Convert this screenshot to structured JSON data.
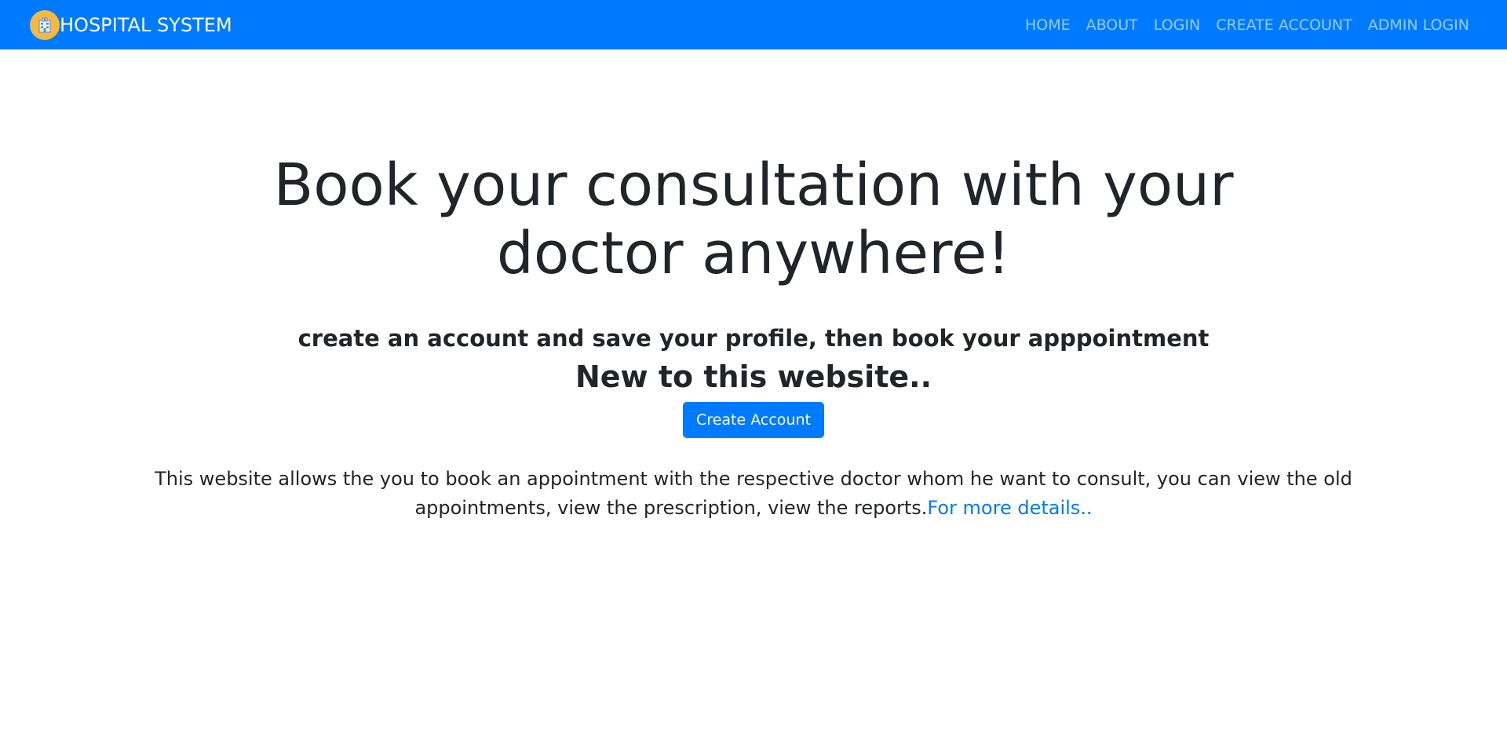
{
  "navbar": {
    "brand_text": "HOSPITAL SYSTEM",
    "brand_icon": "hospital-icon",
    "accent_color": "#007bff",
    "links": [
      {
        "label": "HOME"
      },
      {
        "label": "ABOUT"
      },
      {
        "label": "LOGIN"
      },
      {
        "label": "CREATE ACCOUNT"
      },
      {
        "label": "ADMIN LOGIN"
      }
    ]
  },
  "hero": {
    "title": "Book your consultation with your doctor anywhere!",
    "subtitle": "create an account and save your profile, then book your apppointment",
    "new_heading": "New to this website..",
    "cta_label": "Create Account",
    "description": "This website allows the you to book an appointment with the respective doctor whom he want to consult, you can view the old appointments, view the prescription, view the reports.",
    "more_link": "For more details.."
  }
}
